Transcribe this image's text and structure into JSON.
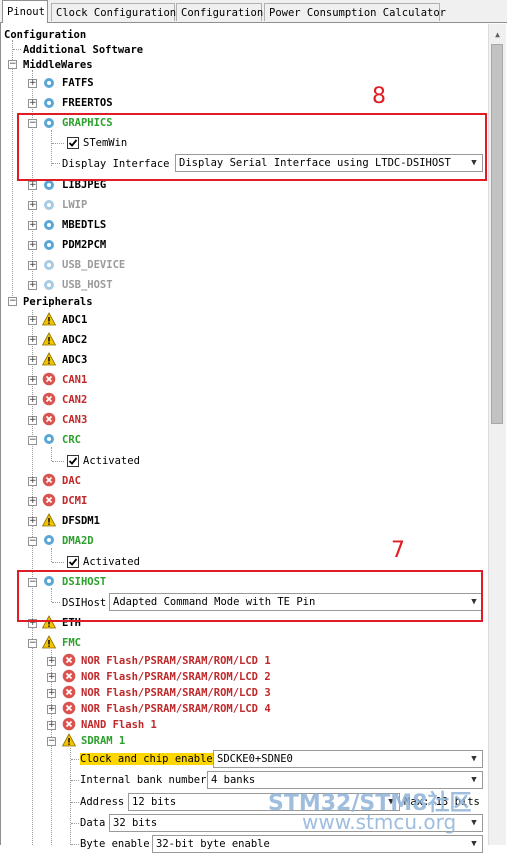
{
  "tabs": [
    "Pinout",
    "Clock Configuration",
    "Configuration",
    "Power Consumption Calculator"
  ],
  "tree": {
    "root": "Configuration",
    "additional": "Additional Software",
    "middlewares": "MiddleWares",
    "fatfs": "FATFS",
    "freertos": "FREERTOS",
    "graphics": "GRAPHICS",
    "stemwin": "STemWin",
    "display_interface_label": "Display Interface",
    "display_interface_value": "Display Serial Interface using LTDC-DSIHOST",
    "libjpeg": "LIBJPEG",
    "lwip": "LWIP",
    "mbedtls": "MBEDTLS",
    "pdm2pcm": "PDM2PCM",
    "usb_device": "USB_DEVICE",
    "usb_host": "USB_HOST",
    "peripherals": "Peripherals",
    "adc1": "ADC1",
    "adc2": "ADC2",
    "adc3": "ADC3",
    "can1": "CAN1",
    "can2": "CAN2",
    "can3": "CAN3",
    "crc": "CRC",
    "activated": "Activated",
    "dac": "DAC",
    "dcmi": "DCMI",
    "dfsdm1": "DFSDM1",
    "dma2d": "DMA2D",
    "dsihost": "DSIHOST",
    "dsihost_label": "DSIHost",
    "dsihost_value": "Adapted Command Mode with TE Pin",
    "eth": "ETH",
    "fmc": "FMC",
    "nor1": "NOR Flash/PSRAM/SRAM/ROM/LCD 1",
    "nor2": "NOR Flash/PSRAM/SRAM/ROM/LCD 2",
    "nor3": "NOR Flash/PSRAM/SRAM/ROM/LCD 3",
    "nor4": "NOR Flash/PSRAM/SRAM/ROM/LCD 4",
    "nand": "NAND Flash 1",
    "sdram": "SDRAM 1",
    "clock_label": "Clock and chip enable",
    "clock_value": "SDCKE0+SDNE0",
    "bank_label": "Internal bank number",
    "bank_value": "4 banks",
    "address_label": "Address",
    "address_value": "12 bits",
    "max_label": "Max: 13 bits",
    "data_label": "Data",
    "data_value": "32 bits",
    "byte_label": "Byte enable",
    "byte_value": "32-bit byte enable"
  },
  "annotations": {
    "n8": "8",
    "n7": "7"
  },
  "watermark": {
    "line1": "STM32/STM8社区",
    "line2": "www.stmcu.org"
  }
}
